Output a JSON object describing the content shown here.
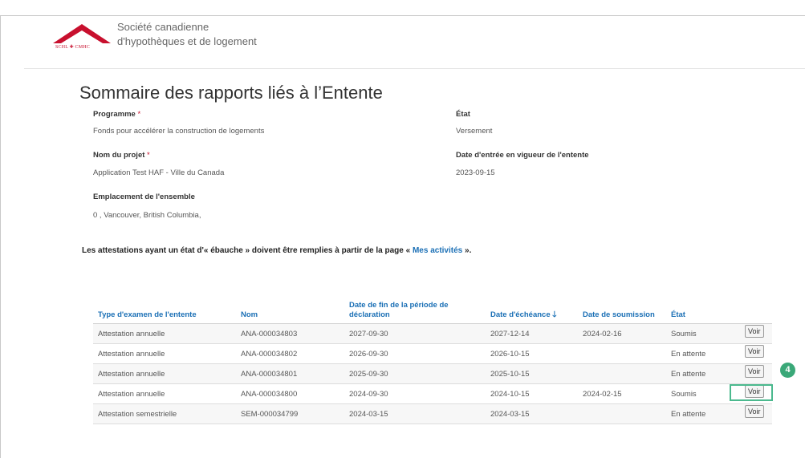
{
  "brand": {
    "abbr": "SCHL ✚ CMHC",
    "name_line1": "Société canadienne",
    "name_line2": "d'hypothèques et de logement",
    "color": "#c8102e"
  },
  "page_title": "Sommaire des rapports liés à l’Entente",
  "fields": {
    "program": {
      "label": "Programme",
      "required_mark": "*",
      "value": "Fonds pour accélérer la construction de logements"
    },
    "state": {
      "label": "État",
      "value": "Versement"
    },
    "project": {
      "label": "Nom du projet",
      "required_mark": "*",
      "value": "Application Test HAF - Ville du Canada"
    },
    "effective_date": {
      "label": "Date d'entrée en vigueur de l'entente",
      "value": "2023-09-15"
    },
    "location": {
      "label": "Emplacement de l'ensemble",
      "value": "0 , Vancouver, British Columbia,"
    }
  },
  "notice": {
    "before": "Les attestations ayant un état d'« ébauche » doivent être remplies à partir de la page «",
    "link": "Mes activités",
    "after": "»."
  },
  "table": {
    "headers": [
      "Type d'examen de l'entente",
      "Nom",
      "Date de fin de la période de déclaration",
      "Date d'échéance",
      "Date de soumission",
      "État"
    ],
    "sort_icon": "arrow-down-icon",
    "rows": [
      {
        "type": "Attestation annuelle",
        "name": "ANA-000034803",
        "period_end": "2027-09-30",
        "due": "2027-12-14",
        "submitted": "2024-02-16",
        "state": "Soumis",
        "action": "Voir"
      },
      {
        "type": "Attestation annuelle",
        "name": "ANA-000034802",
        "period_end": "2026-09-30",
        "due": "2026-10-15",
        "submitted": "",
        "state": "En attente",
        "action": "Voir"
      },
      {
        "type": "Attestation annuelle",
        "name": "ANA-000034801",
        "period_end": "2025-09-30",
        "due": "2025-10-15",
        "submitted": "",
        "state": "En attente",
        "action": "Voir"
      },
      {
        "type": "Attestation annuelle",
        "name": "ANA-000034800",
        "period_end": "2024-09-30",
        "due": "2024-10-15",
        "submitted": "2024-02-15",
        "state": "Soumis",
        "action": "Voir"
      },
      {
        "type": "Attestation semestrielle",
        "name": "SEM-000034799",
        "period_end": "2024-03-15",
        "due": "2024-03-15",
        "submitted": "",
        "state": "En attente",
        "action": "Voir"
      }
    ]
  },
  "callout": {
    "step": "4",
    "color": "#3aa878"
  }
}
